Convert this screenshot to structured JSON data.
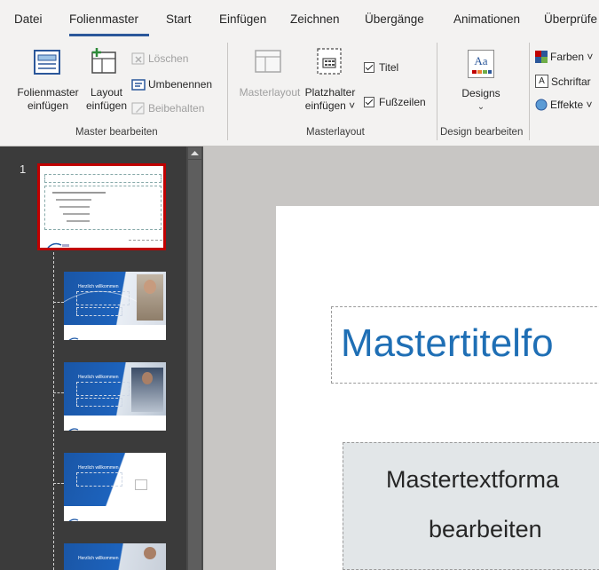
{
  "tabs": [
    "Datei",
    "Folienmaster",
    "Start",
    "Einfügen",
    "Zeichnen",
    "Übergänge",
    "Animationen",
    "Überprüfe"
  ],
  "active_tab": "Folienmaster",
  "groups": {
    "master": {
      "label": "Master bearbeiten",
      "folienmaster_einfuegen": [
        "Folienmaster",
        "einfügen"
      ],
      "layout_einfuegen": [
        "Layout",
        "einfügen"
      ],
      "loeschen": "Löschen",
      "umbenennen": "Umbenennen",
      "beibehalten": "Beibehalten"
    },
    "layout": {
      "label": "Masterlayout",
      "masterlayout": "Masterlayout",
      "platzhalter": [
        "Platzhalter",
        "einfügen ˅"
      ],
      "titel": "Titel",
      "fusszeilen": "Fußzeilen"
    },
    "design": {
      "label": "Design bearbeiten",
      "designs": "Designs",
      "designs_icon_text": "Aa"
    },
    "background": {
      "farben": "Farben ˅",
      "schriftarten": "Schriftar",
      "schriftarten_icon_text": "A",
      "effekte": "Effekte ˅"
    }
  },
  "thumbnails": {
    "slide_number": "1",
    "layout_title": "Herzlich willkommen"
  },
  "slide": {
    "title": "Mastertitelfo",
    "text_line1": "Mastertextforma",
    "text_line2": "bearbeiten"
  },
  "colors": {
    "accent": "#2b579a",
    "title_blue": "#1f6fb5",
    "selected_border": "#c00000"
  }
}
